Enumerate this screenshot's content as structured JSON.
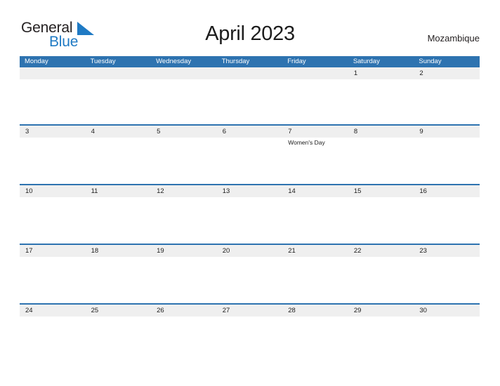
{
  "logo": {
    "word_one": "General",
    "word_two": "Blue",
    "flag_icon": "blue-triangle-flag-icon",
    "blue_color": "#1f7ac4"
  },
  "header": {
    "title": "April 2023",
    "country": "Mozambique"
  },
  "calendar": {
    "accent_color": "#2e73b0",
    "band_color": "#efefef",
    "weekdays": [
      "Monday",
      "Tuesday",
      "Wednesday",
      "Thursday",
      "Friday",
      "Saturday",
      "Sunday"
    ],
    "weeks": [
      [
        {
          "day": "",
          "events": []
        },
        {
          "day": "",
          "events": []
        },
        {
          "day": "",
          "events": []
        },
        {
          "day": "",
          "events": []
        },
        {
          "day": "",
          "events": []
        },
        {
          "day": "1",
          "events": []
        },
        {
          "day": "2",
          "events": []
        }
      ],
      [
        {
          "day": "3",
          "events": []
        },
        {
          "day": "4",
          "events": []
        },
        {
          "day": "5",
          "events": []
        },
        {
          "day": "6",
          "events": []
        },
        {
          "day": "7",
          "events": [
            "Women's Day"
          ]
        },
        {
          "day": "8",
          "events": []
        },
        {
          "day": "9",
          "events": []
        }
      ],
      [
        {
          "day": "10",
          "events": []
        },
        {
          "day": "11",
          "events": []
        },
        {
          "day": "12",
          "events": []
        },
        {
          "day": "13",
          "events": []
        },
        {
          "day": "14",
          "events": []
        },
        {
          "day": "15",
          "events": []
        },
        {
          "day": "16",
          "events": []
        }
      ],
      [
        {
          "day": "17",
          "events": []
        },
        {
          "day": "18",
          "events": []
        },
        {
          "day": "19",
          "events": []
        },
        {
          "day": "20",
          "events": []
        },
        {
          "day": "21",
          "events": []
        },
        {
          "day": "22",
          "events": []
        },
        {
          "day": "23",
          "events": []
        }
      ],
      [
        {
          "day": "24",
          "events": []
        },
        {
          "day": "25",
          "events": []
        },
        {
          "day": "26",
          "events": []
        },
        {
          "day": "27",
          "events": []
        },
        {
          "day": "28",
          "events": []
        },
        {
          "day": "29",
          "events": []
        },
        {
          "day": "30",
          "events": []
        }
      ]
    ]
  }
}
